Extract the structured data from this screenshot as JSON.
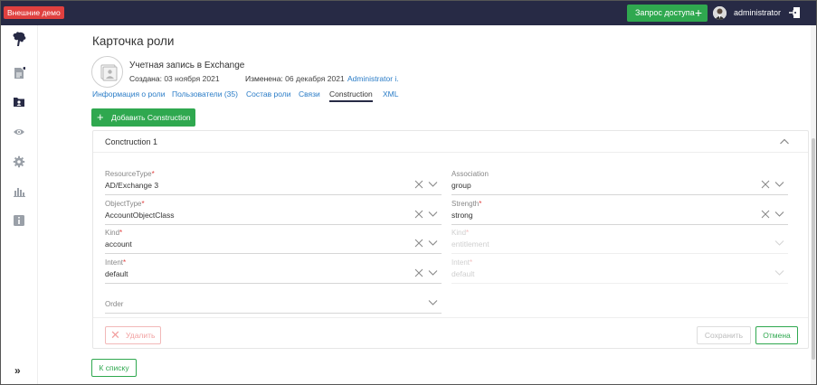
{
  "topbar": {
    "demo_badge": "Внешние демо",
    "request_button": "Запрос доступа",
    "username": "administrator"
  },
  "sidebar": {
    "items": [
      "logo-icon",
      "document-icon",
      "roles-icon",
      "eye-icon",
      "gear-icon",
      "chart-icon",
      "info-icon"
    ],
    "expand_label": "»"
  },
  "page": {
    "title": "Карточка роли",
    "role_name": "Учетная запись в Exchange",
    "created_label": "Создана:",
    "created_value": "03 ноября 2021",
    "changed_label": "Изменена:",
    "changed_value": "06 декабря 2021",
    "changed_by": "Administrator i."
  },
  "tabs": [
    {
      "label": "Информация о роли",
      "active": false
    },
    {
      "label": "Пользователи (35)",
      "active": false
    },
    {
      "label": "Состав роли",
      "active": false
    },
    {
      "label": "Связи",
      "active": false
    },
    {
      "label": "Construction",
      "active": true
    },
    {
      "label": "XML",
      "active": false
    }
  ],
  "add_button": "Добавить Construction",
  "construction": {
    "title": "Cоnctruction 1",
    "fields": {
      "resource_type": {
        "label": "ResourceType",
        "required": "*",
        "value": "AD/Exchange 3"
      },
      "object_type": {
        "label": "ObjectType",
        "required": "*",
        "value": "AccountObjectClass"
      },
      "kind": {
        "label": "Kind",
        "required": "*",
        "value": "account"
      },
      "intent": {
        "label": "Intent",
        "required": "*",
        "value": "default"
      },
      "order": {
        "label": "Order",
        "value": ""
      },
      "association": {
        "label": "Association",
        "value": "group"
      },
      "strength": {
        "label": "Strength",
        "required": "*",
        "value": "strong"
      },
      "kind2": {
        "label": "Kind",
        "required": "*",
        "value": "entitlement"
      },
      "intent2": {
        "label": "Intent",
        "required": "*",
        "value": "default"
      }
    },
    "delete_button": "Удалить",
    "save_button": "Сохранить",
    "cancel_button": "Отмена"
  },
  "back_button": "К списку",
  "colors": {
    "topbar": "#272a45",
    "accent_green": "#2fa84f",
    "link_blue": "#2a7cc7",
    "danger": "#e0403f"
  }
}
